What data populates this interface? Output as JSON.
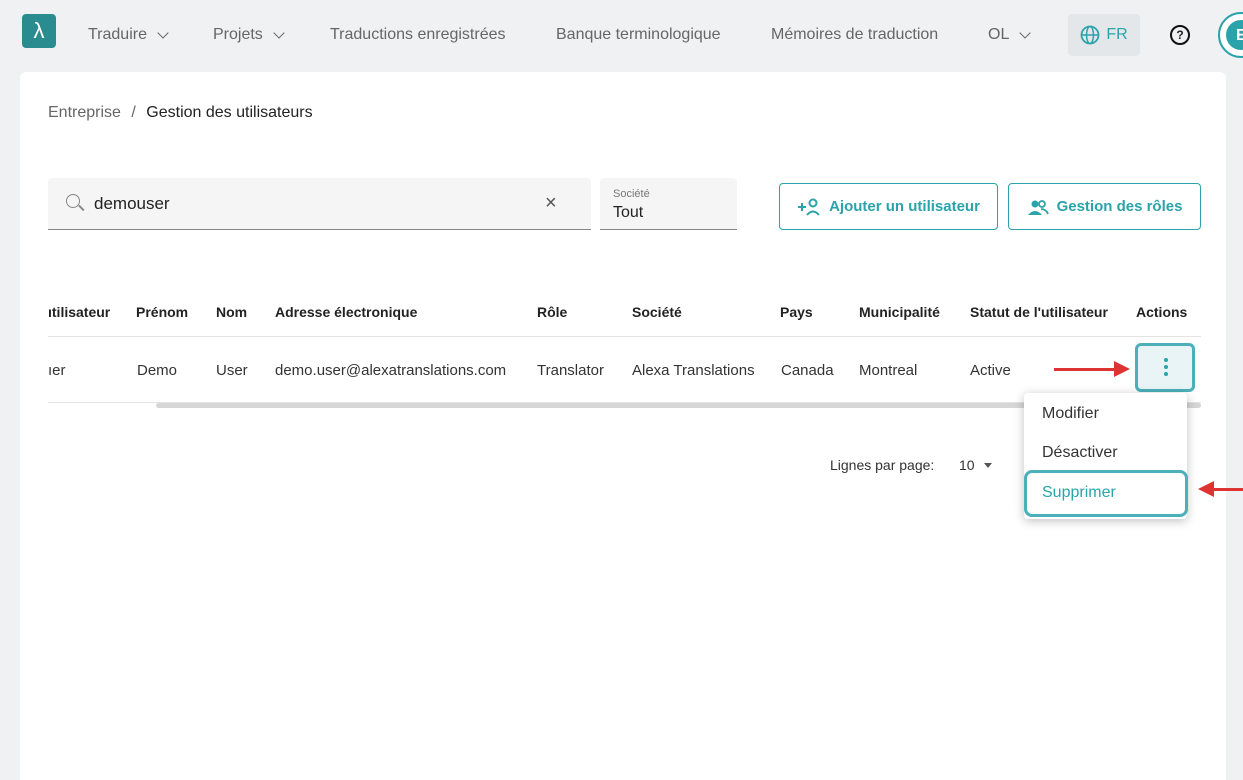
{
  "nav": {
    "logo": "λ",
    "items": [
      "Traduire",
      "Projets",
      "Traductions enregistrées",
      "Banque terminologique",
      "Mémoires de traduction",
      "OL"
    ],
    "language": "FR",
    "help": "?",
    "avatar_initial": "E"
  },
  "breadcrumb": {
    "parent": "Entreprise",
    "separator": "/",
    "current": "Gestion des utilisateurs"
  },
  "search": {
    "value": "demouser",
    "clear": "×"
  },
  "company_filter": {
    "label": "Société",
    "value": "Tout"
  },
  "buttons": {
    "add_user": "Ajouter un utilisateur",
    "roles": "Gestion des rôles"
  },
  "table": {
    "headers": [
      "ıtilisateur",
      "Prénom",
      "Nom",
      "Adresse électronique",
      "Rôle",
      "Société",
      "Pays",
      "Municipalité",
      "Statut de l'utilisateur",
      "Actions"
    ],
    "row": [
      "ıer",
      "Demo",
      "User",
      "demo.user@alexatranslations.com",
      "Translator",
      "Alexa Translations",
      "Canada",
      "Montreal",
      "Active"
    ]
  },
  "pagination": {
    "label": "Lignes par page:",
    "value": "10"
  },
  "menu": {
    "items": [
      "Modifier",
      "Désactiver",
      "Supprimer"
    ]
  },
  "colors": {
    "accent": "#2aa3aa",
    "annotation": "#dd3333"
  }
}
